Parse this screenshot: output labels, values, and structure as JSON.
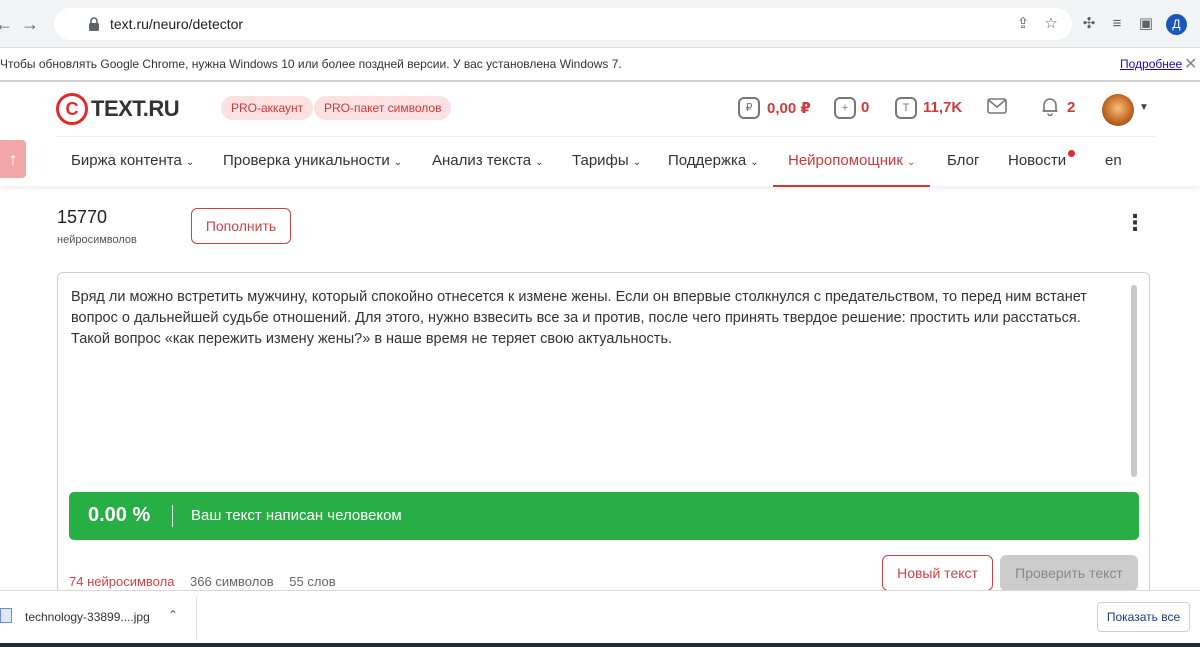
{
  "browser": {
    "url": "text.ru/neuro/detector",
    "profile_initial": "Д",
    "infobar_text": "Чтобы обновлять Google Chrome, нужна Windows 10 или более поздней версии. У вас установлена Windows 7.",
    "infobar_link": "Подробнее",
    "close_glyph": "✕"
  },
  "header": {
    "logo_mark": "C",
    "logo_text": "TEXT.RU",
    "pro_account": "PRO-аккаунт",
    "pro_pack": "PRO-пакет символов",
    "balance": "0,00 ₽",
    "tasks": "0",
    "symbols": "11,7K",
    "notifications": "2",
    "accent_color": "#d0393a"
  },
  "nav": {
    "items": [
      {
        "label": "Биржа контента",
        "dropdown": true
      },
      {
        "label": "Проверка уникальности",
        "dropdown": true
      },
      {
        "label": "Анализ текста",
        "dropdown": true
      },
      {
        "label": "Тарифы",
        "dropdown": true
      },
      {
        "label": "Поддержка",
        "dropdown": true
      },
      {
        "label": "Нейропомощник",
        "dropdown": true,
        "active": true
      },
      {
        "label": "Блог",
        "dropdown": false
      },
      {
        "label": "Новости",
        "dropdown": false
      },
      {
        "label": "en",
        "dropdown": false
      }
    ],
    "chevron": "⌄"
  },
  "counter": {
    "value": "15770",
    "label": "нейросимволов",
    "topup_button": "Пополнить"
  },
  "editor": {
    "text": "Вряд ли можно встретить мужчину, который спокойно отнесется к измене жены. Если он впервые столкнулся с предательством, то перед ним встанет вопрос о дальнейшей судьбе отношений. Для этого, нужно взвесить все за и против, после чего принять твердое решение: простить или расстаться. Такой вопрос «как пережить измену жены?» в наше время не теряет свою актуальность."
  },
  "result": {
    "percent": "0.00 %",
    "message": "Ваш текст написан человеком",
    "color": "#27ae44"
  },
  "stats": {
    "neuro": "74 нейросимвола",
    "chars": "366 символов",
    "words": "55 слов"
  },
  "actions": {
    "new_text": "Новый текст",
    "check_text": "Проверить текст"
  },
  "downloads": {
    "file_name": "technology-33899....jpg",
    "show_all": "Показать все"
  }
}
